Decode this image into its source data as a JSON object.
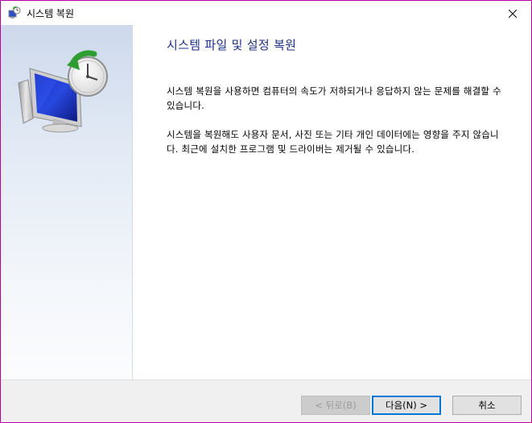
{
  "window": {
    "title": "시스템 복원"
  },
  "page": {
    "heading": "시스템 파일 및 설정 복원",
    "paragraphs": [
      "시스템 복원을 사용하면 컴퓨터의 속도가 저하되거나 응답하지 않는 문제를 해결할 수 있습니다.",
      "시스템을 복원해도 사용자 문서, 사진 또는 기타 개인 데이터에는 영향을 주지 않습니다. 최근에 설치한 프로그램 및 드라이버는 제거될 수 있습니다."
    ]
  },
  "footer": {
    "back_label": "< 뒤로(B)",
    "next_label": "다음(N) >",
    "cancel_label": "취소"
  },
  "icons": {
    "app": "system-restore-icon",
    "close": "close-icon",
    "illustration": "system-restore-monitor-clock"
  },
  "colors": {
    "heading": "#1e3287",
    "window_border": "#b4009e",
    "primary_button_border": "#0078d7"
  }
}
